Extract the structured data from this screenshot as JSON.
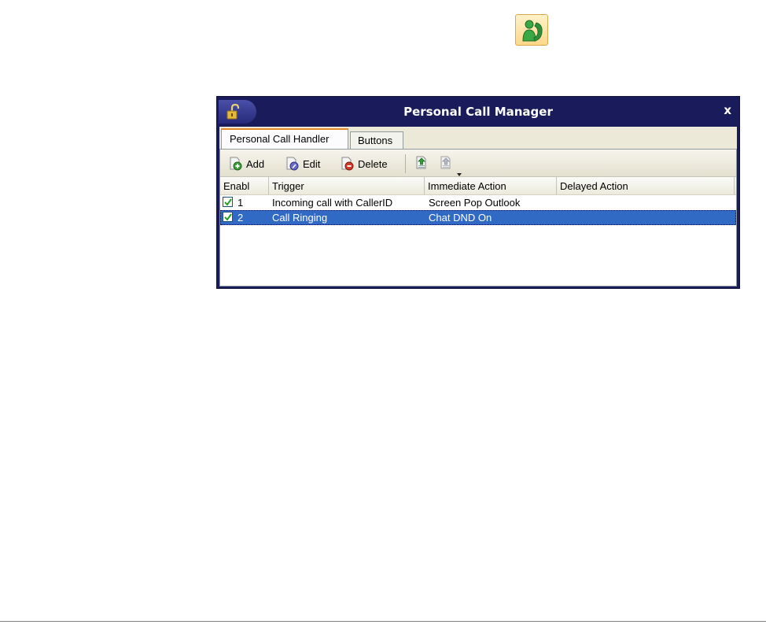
{
  "window": {
    "title": "Personal Call Manager",
    "close_label": "x"
  },
  "tabs": [
    {
      "label": "Personal Call Handler",
      "active": true
    },
    {
      "label": "Buttons",
      "active": false
    }
  ],
  "toolbar": {
    "add_label": "Add",
    "edit_label": "Edit",
    "delete_label": "Delete",
    "icons": [
      "import-icon",
      "export-icon",
      "dropdown-arrow-icon",
      "lock-icon",
      "phone-contact-icon"
    ]
  },
  "grid": {
    "columns": [
      "Enabl",
      "Trigger",
      "Immediate Action",
      "Delayed Action"
    ],
    "rows": [
      {
        "enabled": true,
        "id": "1",
        "trigger": "Incoming call with CallerID",
        "immediate": "Screen Pop Outlook",
        "delayed": "",
        "selected": false
      },
      {
        "enabled": true,
        "id": "2",
        "trigger": "Call Ringing",
        "immediate": "Chat DND On",
        "delayed": "",
        "selected": true
      }
    ]
  },
  "colors": {
    "titlebar": "#191b5b",
    "selection": "#316ac5",
    "tab_accent": "#e68b2c"
  }
}
